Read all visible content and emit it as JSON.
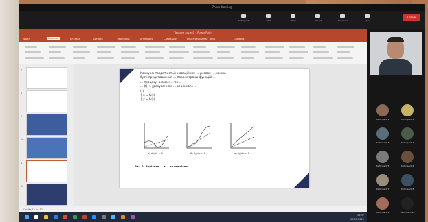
{
  "zoom": {
    "title": "Zoom Meeting",
    "toolbar": [
      {
        "label": "Participants",
        "icon": "participants-icon"
      },
      {
        "label": "Chat",
        "icon": "chat-icon"
      },
      {
        "label": "Share",
        "icon": "share-screen-icon"
      },
      {
        "label": "Record",
        "icon": "record-icon"
      },
      {
        "label": "Reactions",
        "icon": "reactions-icon"
      },
      {
        "label": "View",
        "icon": "view-icon"
      }
    ],
    "leave_label": "Leave"
  },
  "powerpoint": {
    "window_title": "Презентация1 - PowerPoint",
    "tabs": [
      "Файл",
      "Главная",
      "Вставка",
      "Дизайн",
      "Переходы",
      "Анимация",
      "Слайд-шоу",
      "Рецензирование",
      "Вид",
      "Справка"
    ],
    "slide_numbers": [
      "7",
      "8",
      "9",
      "10",
      "11",
      "12"
    ],
    "status_text": "Слайд 11 из 12"
  },
  "slide": {
    "text_lines": [
      "Конкурентоздатність інноваційних ... умовах ... можна",
      "бути представлений ... параметрами функцій ...",
      "... процесу, а саме: ... та ... ",
      "... (t), з урахуванням ... реального ...",
      "(t):",
      "{ x = f₁(t)",
      "{ y = f₂(t)"
    ],
    "graph_captions": [
      "а) dy/dx > 0",
      "б) dy/dx > 0",
      "в) dy/dx > 0"
    ],
    "figure_caption": "Рис. 1. Варіанти ... з ... залежністю ..."
  },
  "participants": [
    {
      "name": "Participant 1",
      "color": "#8a6a55"
    },
    {
      "name": "Participant 2",
      "color": "#c7b26a"
    },
    {
      "name": "Participant 3",
      "color": "#5a6e7a"
    },
    {
      "name": "Participant 4",
      "color": "#4d5a48"
    },
    {
      "name": "Participant 5",
      "color": "#7b7b7b"
    },
    {
      "name": "Participant 6",
      "color": "#6a4f3f"
    },
    {
      "name": "Participant 7",
      "color": "#9a8c7a"
    },
    {
      "name": "Participant 8",
      "color": "#3d4f63"
    },
    {
      "name": "Participant 9",
      "color": "#a16d5a"
    },
    {
      "name": "Participant 10",
      "color": "#222222"
    }
  ],
  "taskbar_clock": {
    "time": "12:37",
    "date": "19.03.2021"
  },
  "colors": {
    "ppt_red": "#b7472a",
    "slide_navy": "#25305d",
    "zoom_red": "#d3322c"
  }
}
